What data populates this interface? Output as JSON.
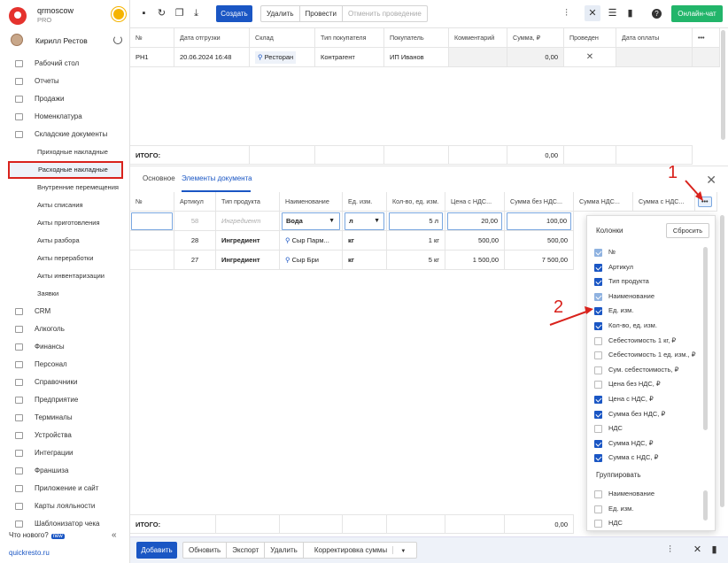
{
  "brand": {
    "name": "qrmoscow",
    "plan": "PRO"
  },
  "user": {
    "name": "Кирилл Рестов"
  },
  "nav": [
    {
      "label": "Рабочий стол",
      "icon": "dashboard-icon"
    },
    {
      "label": "Отчеты",
      "icon": "reports-icon"
    },
    {
      "label": "Продажи",
      "icon": "sales-icon"
    },
    {
      "label": "Номенклатура",
      "icon": "nomenclature-icon"
    },
    {
      "label": "Складские документы",
      "icon": "warehouse-icon"
    }
  ],
  "nav_sub": [
    {
      "label": "Приходные накладные"
    },
    {
      "label": "Расходные накладные"
    },
    {
      "label": "Внутренние перемещения"
    },
    {
      "label": "Акты списания"
    },
    {
      "label": "Акты приготовления"
    },
    {
      "label": "Акты разбора"
    },
    {
      "label": "Акты переработки"
    },
    {
      "label": "Акты инвентаризации"
    },
    {
      "label": "Заявки"
    }
  ],
  "nav_more": [
    {
      "label": "CRM",
      "icon": "crm-icon"
    },
    {
      "label": "Алкоголь",
      "icon": "alcohol-icon"
    },
    {
      "label": "Финансы",
      "icon": "finance-icon"
    },
    {
      "label": "Персонал",
      "icon": "staff-icon"
    },
    {
      "label": "Справочники",
      "icon": "directory-icon"
    },
    {
      "label": "Предприятие",
      "icon": "company-icon"
    },
    {
      "label": "Терминалы",
      "icon": "terminal-icon"
    },
    {
      "label": "Устройства",
      "icon": "device-icon"
    },
    {
      "label": "Интеграции",
      "icon": "integration-icon"
    },
    {
      "label": "Франшиза",
      "icon": "franchise-icon"
    },
    {
      "label": "Приложение и сайт",
      "icon": "app-icon"
    },
    {
      "label": "Карты лояльности",
      "icon": "loyalty-icon"
    },
    {
      "label": "Шаблонизатор чека",
      "icon": "receipt-icon"
    }
  ],
  "footer": {
    "whats_new": "Что нового?",
    "new_badge": "new",
    "site": "quickresto.ru"
  },
  "toolbar": {
    "create": "Создать",
    "delete": "Удалить",
    "post": "Провести",
    "unpost": "Отменить проведение",
    "chat": "Онлайн-чат"
  },
  "top_table": {
    "headers": [
      "№",
      "Дата отгрузки",
      "Склад",
      "Тип покупателя",
      "Покупатель",
      "Комментарий",
      "Сумма, ₽",
      "Проведен",
      "Дата оплаты"
    ],
    "row": [
      "РН1",
      "20.06.2024 16:48",
      "Ресторан",
      "Контрагент",
      "ИП Иванов",
      "",
      "0,00",
      "✕",
      ""
    ],
    "total_label": "ИТОГО:",
    "total_sum": "0,00"
  },
  "tabs": [
    {
      "label": "Основное"
    },
    {
      "label": "Элементы документа"
    }
  ],
  "detail": {
    "headers": [
      "№",
      "Артикул",
      "Тип продукта",
      "Наименование",
      "Ед. изм.",
      "Кол-во, ед. изм.",
      "Цена с НДС...",
      "Сумма без НДС...",
      "Сумма НДС...",
      "Сумма с НДС..."
    ],
    "rows": [
      {
        "article": "58",
        "type": "Ингредиент",
        "name": "Вода",
        "unit": "л",
        "qty": "5 л",
        "price": "20,00",
        "sum_no_vat": "100,00"
      },
      {
        "article": "28",
        "type": "Ингредиент",
        "name": "Сыр Парм...",
        "unit": "кг",
        "qty": "1 кг",
        "price": "500,00",
        "sum_no_vat": "500,00"
      },
      {
        "article": "27",
        "type": "Ингредиент",
        "name": "Сыр Бри",
        "unit": "кг",
        "qty": "5 кг",
        "price": "1 500,00",
        "sum_no_vat": "7 500,00"
      }
    ],
    "total_label": "ИТОГО:",
    "total_sum": "0,00"
  },
  "columns_panel": {
    "title": "Колонки",
    "reset": "Сбросить",
    "items": [
      {
        "label": "№",
        "state": "disabled"
      },
      {
        "label": "Артикул",
        "state": "on"
      },
      {
        "label": "Тип продукта",
        "state": "on"
      },
      {
        "label": "Наименование",
        "state": "disabled"
      },
      {
        "label": "Ед. изм.",
        "state": "on"
      },
      {
        "label": "Кол-во, ед. изм.",
        "state": "on"
      },
      {
        "label": "Себестоимость 1 кг, ₽",
        "state": "off"
      },
      {
        "label": "Себестоимость 1 ед. изм., ₽",
        "state": "off"
      },
      {
        "label": "Сум. себестоимость, ₽",
        "state": "off"
      },
      {
        "label": "Цена без НДС, ₽",
        "state": "off"
      },
      {
        "label": "Цена с НДС, ₽",
        "state": "on"
      },
      {
        "label": "Сумма без НДС, ₽",
        "state": "on"
      },
      {
        "label": "НДС",
        "state": "off"
      },
      {
        "label": "Сумма НДС, ₽",
        "state": "on"
      },
      {
        "label": "Сумма с НДС, ₽",
        "state": "on"
      }
    ],
    "group_title": "Группировать",
    "group_items": [
      {
        "label": "Наименование",
        "state": "off"
      },
      {
        "label": "Ед. изм.",
        "state": "off"
      },
      {
        "label": "НДС",
        "state": "off"
      }
    ]
  },
  "bottom_bar": {
    "add": "Добавить",
    "refresh": "Обновить",
    "export": "Экспорт",
    "delete": "Удалить",
    "correct": "Корректировка суммы"
  },
  "annotations": {
    "one": "1",
    "two": "2"
  },
  "colors": {
    "accent": "#1a56c4",
    "green": "#22b56a",
    "highlight": "#d9221c"
  }
}
